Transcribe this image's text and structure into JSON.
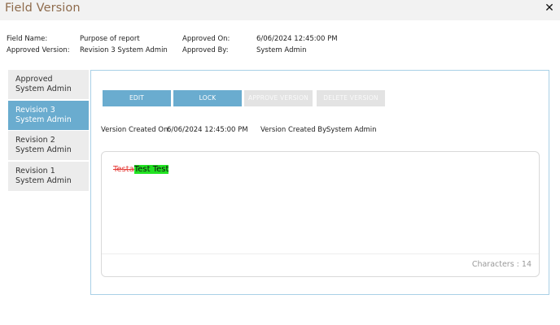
{
  "dialog": {
    "title": "Field Version"
  },
  "field_info": {
    "field_name_label": "Field Name:",
    "field_name_value": "Purpose of report",
    "approved_version_label": "Approved Version:",
    "approved_version_value": "Revision 3 System Admin",
    "approved_on_label": "Approved On:",
    "approved_on_value": "6/06/2024 12:45:00 PM",
    "approved_by_label": "Approved By:",
    "approved_by_value": "System Admin"
  },
  "versions": [
    {
      "name": "Approved",
      "user": "System Admin",
      "active": false
    },
    {
      "name": "Revision 3",
      "user": "System Admin",
      "active": true
    },
    {
      "name": "Revision 2",
      "user": "System Admin",
      "active": false
    },
    {
      "name": "Revision 1",
      "user": "System Admin",
      "active": false
    }
  ],
  "toolbar": {
    "edit_label": "EDIT",
    "lock_label": "LOCK",
    "approve_label": "APPROVE VERSION",
    "delete_label": "DELETE VERSION"
  },
  "version_info": {
    "created_on_label": "Version Created On:",
    "created_on_value": "6/06/2024 12:45:00 PM",
    "created_by_label": "Version Created By:",
    "created_by_value": "System Admin"
  },
  "editor": {
    "deleted_text": "Testa",
    "inserted_text": "Test Test",
    "char_count": "Characters : 14"
  },
  "colors": {
    "accent": "#6aaccf",
    "title": "#8e6b4c",
    "deleted": "#e53935",
    "inserted_bg": "#22e222"
  }
}
